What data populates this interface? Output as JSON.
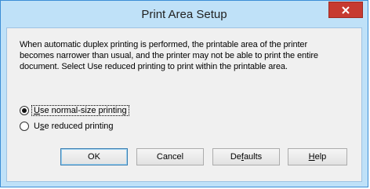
{
  "window": {
    "title": "Print Area Setup"
  },
  "close_label": "×",
  "message": "When automatic duplex printing is performed, the printable area of the printer becomes narrower than usual, and the printer may not be able to print the entire document. Select Use reduced printing to print within the printable area.",
  "options": [
    {
      "prefix": "",
      "access": "U",
      "rest": "se normal-size printing",
      "selected": true
    },
    {
      "prefix": "U",
      "access": "s",
      "rest": "e reduced printing",
      "selected": false
    }
  ],
  "buttons": {
    "ok": "OK",
    "cancel": "Cancel",
    "defaults": {
      "prefix": "De",
      "access": "f",
      "rest": "aults"
    },
    "help": {
      "prefix": "",
      "access": "H",
      "rest": "elp"
    }
  },
  "colors": {
    "title_bar": "#bfe1f8",
    "close_button": "#c73a30",
    "client_bg": "#f0f0f0"
  }
}
